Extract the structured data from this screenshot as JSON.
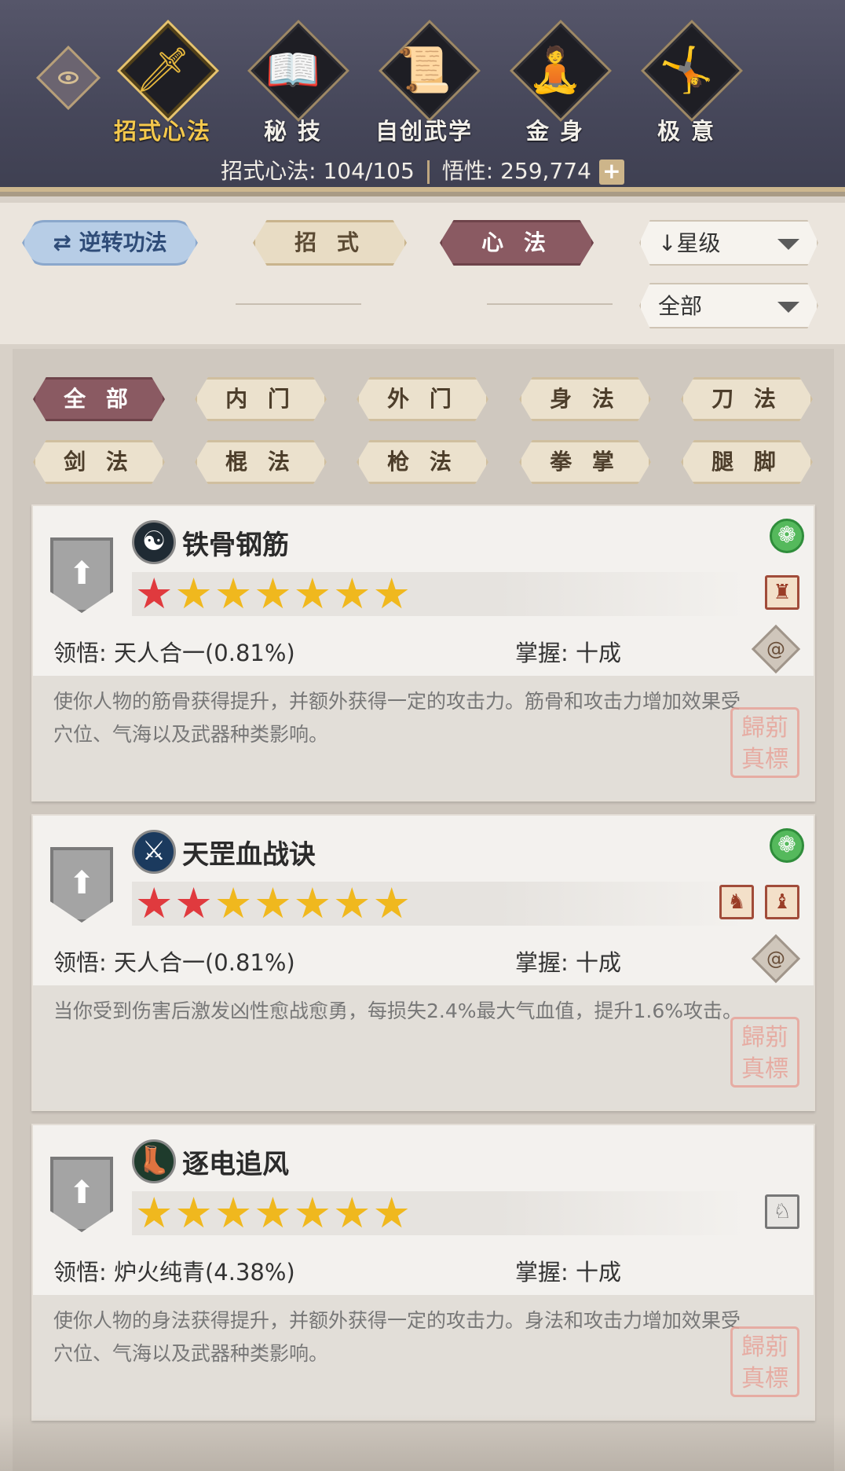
{
  "nav": {
    "eye_icon": "eye-icon",
    "tabs": [
      {
        "label": "招式心法",
        "icon": "sword-icon",
        "glyph": "🗡",
        "active": true
      },
      {
        "label": "秘 技",
        "icon": "book-icon",
        "glyph": "📖",
        "active": false
      },
      {
        "label": "自创武学",
        "icon": "scroll-brush-icon",
        "glyph": "📜",
        "active": false
      },
      {
        "label": "金 身",
        "icon": "meditation-figure-icon",
        "glyph": "🧘",
        "active": false
      },
      {
        "label": "极 意",
        "icon": "martial-stance-icon",
        "glyph": "🤸",
        "active": false
      }
    ]
  },
  "stats": {
    "moves_label": "招式心法: 104/105",
    "insight_label": "悟性: 259,774",
    "plus": "+"
  },
  "controls": {
    "reverse_label": "⇄ 逆转功法",
    "moves_pill": "招 式",
    "mind_pill": "心 法",
    "sort_dropdown": "↓星级",
    "filter_dropdown": "全部"
  },
  "categories": [
    {
      "label": "全 部",
      "active": true
    },
    {
      "label": "内 门",
      "active": false
    },
    {
      "label": "外 门",
      "active": false
    },
    {
      "label": "身 法",
      "active": false
    },
    {
      "label": "刀 法",
      "active": false
    },
    {
      "label": "剑 法",
      "active": false
    },
    {
      "label": "棍 法",
      "active": false
    },
    {
      "label": "枪 法",
      "active": false
    },
    {
      "label": "拳 掌",
      "active": false
    },
    {
      "label": "腿 脚",
      "active": false
    }
  ],
  "skills": [
    {
      "name": "铁骨钢筋",
      "icon": "taiji-icon",
      "icon_glyph": "☯",
      "red_stars": 1,
      "gold_stars": 6,
      "comprehension": "领悟: 天人合一(0.81%)",
      "mastery": "掌握: 十成",
      "description": "使你人物的筋骨获得提升，并额外获得一定的攻击力。筋骨和攻击力增加效果受穴位、气海以及武器种类影响。",
      "seal": "歸莂 真標"
    },
    {
      "name": "天罡血战诀",
      "icon": "blade-slash-icon",
      "icon_glyph": "⚔",
      "red_stars": 2,
      "gold_stars": 5,
      "comprehension": "领悟: 天人合一(0.81%)",
      "mastery": "掌握: 十成",
      "description": "当你受到伤害后激发凶性愈战愈勇，每损失2.4%最大气血值，提升1.6%攻击。",
      "seal": "歸莂 真標"
    },
    {
      "name": "逐电追风",
      "icon": "running-boot-icon",
      "icon_glyph": "👢",
      "red_stars": 0,
      "gold_stars": 7,
      "comprehension": "领悟: 炉火纯青(4.38%)",
      "mastery": "掌握: 十成",
      "description": "使你人物的身法获得提升，并额外获得一定的攻击力。身法和攻击力增加效果受穴位、气海以及武器种类影响。",
      "seal": "歸莂 真標"
    }
  ]
}
